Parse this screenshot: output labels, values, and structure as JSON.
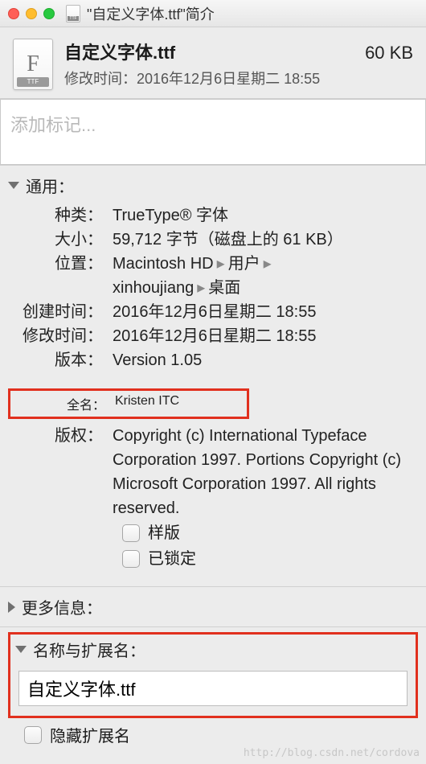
{
  "window": {
    "title": "\"自定义字体.ttf\"简介"
  },
  "header": {
    "filename": "自定义字体.ttf",
    "filesize": "60 KB",
    "modified_label": "修改时间：",
    "modified_value": "2016年12月6日星期二 18:55"
  },
  "tags": {
    "placeholder": "添加标记..."
  },
  "sections": {
    "general": {
      "title": "通用：",
      "kind_label": "种类：",
      "kind_value": "TrueType® 字体",
      "size_label": "大小：",
      "size_value": "59,712 字节（磁盘上的 61 KB）",
      "where_label": "位置：",
      "where_parts": [
        "Macintosh HD",
        "用户",
        "xinhoujiang",
        "桌面"
      ],
      "created_label": "创建时间：",
      "created_value": "2016年12月6日星期二 18:55",
      "modified_label": "修改时间：",
      "modified_value": "2016年12月6日星期二 18:55",
      "version_label": "版本：",
      "version_value": "Version 1.05",
      "fullname_label": "全名：",
      "fullname_value": "Kristen ITC",
      "copyright_label": "版权：",
      "copyright_value": "Copyright (c) International Typeface Corporation 1997. Portions Copyright (c) Microsoft Corporation 1997.  All rights reserved.",
      "sample_label": "样版",
      "locked_label": "已锁定"
    },
    "more_info": {
      "title": "更多信息："
    },
    "name_ext": {
      "title": "名称与扩展名：",
      "value": "自定义字体.ttf",
      "hide_ext_label": "隐藏扩展名"
    }
  },
  "watermark": "http://blog.csdn.net/cordova"
}
